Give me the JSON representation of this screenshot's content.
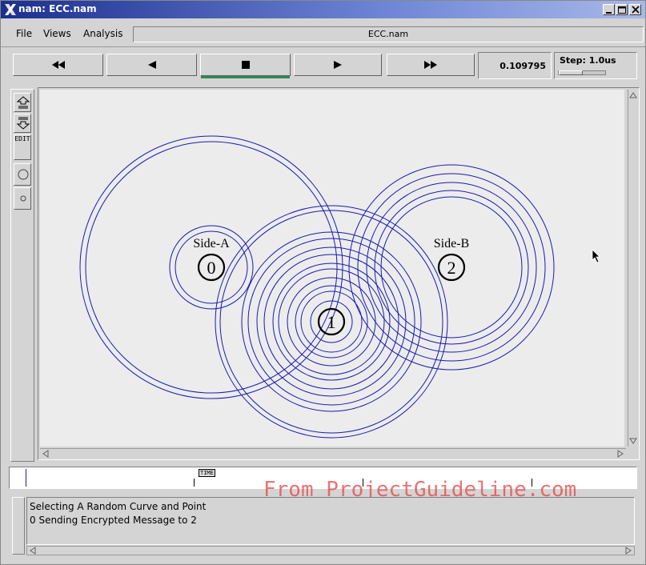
{
  "window": {
    "title": "nam: ECC.nam"
  },
  "menu": {
    "file": "File",
    "views": "Views",
    "analysis": "Analysis",
    "filename": "ECC.nam"
  },
  "playback": {
    "time": "0.109795",
    "step": "Step: 1.0us"
  },
  "sidebar": {
    "edit_label": "EDIT"
  },
  "nodes": [
    {
      "id": "0",
      "label": "Side-A"
    },
    {
      "id": "1",
      "label": ""
    },
    {
      "id": "2",
      "label": "Side-B"
    }
  ],
  "timeline": {
    "marker": "TIME"
  },
  "console": {
    "lines": [
      "Selecting A Random Curve and Point",
      "0 Sending Encrypted Message to 2"
    ]
  },
  "watermark": "From ProjectGuideline.com",
  "colors": {
    "wave": "#1a1ab0",
    "titlebar": "#1c2f8f",
    "active_play": "#2e8b57",
    "watermark": "#e64646"
  }
}
